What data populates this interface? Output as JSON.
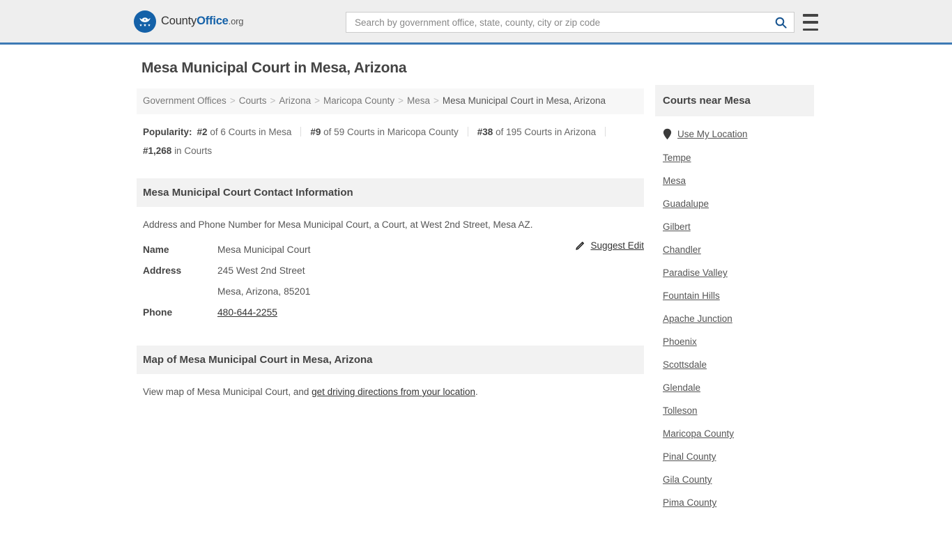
{
  "header": {
    "logo": {
      "name_part1": "County",
      "name_part2": "Office",
      "name_part3": ".org",
      "icon": "eagle-seal-icon"
    },
    "search": {
      "placeholder": "Search by government office, state, county, city or zip code",
      "value": "",
      "icon": "search-icon"
    },
    "menu_icon": "hamburger-menu-icon"
  },
  "main": {
    "page_title": "Mesa Municipal Court in Mesa, Arizona",
    "breadcrumb": {
      "items": [
        "Government Offices",
        "Courts",
        "Arizona",
        "Maricopa County",
        "Mesa"
      ],
      "current": "Mesa Municipal Court in Mesa, Arizona",
      "separator": ">"
    },
    "popularity": {
      "label": "Popularity:",
      "items": [
        {
          "rank": "#2",
          "text": "of 6 Courts in Mesa"
        },
        {
          "rank": "#9",
          "text": "of 59 Courts in Maricopa County"
        },
        {
          "rank": "#38",
          "text": "of 195 Courts in Arizona"
        },
        {
          "rank": "#1,268",
          "text": "in Courts"
        }
      ]
    },
    "contact_section": {
      "heading": "Mesa Municipal Court Contact Information",
      "description": "Address and Phone Number for Mesa Municipal Court, a Court, at West 2nd Street, Mesa AZ.",
      "rows": [
        {
          "key": "Name",
          "value": "Mesa Municipal Court",
          "link": false
        },
        {
          "key": "Address",
          "value": "245 West 2nd Street",
          "link": false
        },
        {
          "key": "",
          "value": "Mesa, Arizona, 85201",
          "link": false
        },
        {
          "key": "Phone",
          "value": "480-644-2255",
          "link": true
        }
      ],
      "suggest_edit": {
        "label": "Suggest Edit",
        "icon": "edit-pencil-icon"
      }
    },
    "map_section": {
      "heading": "Map of Mesa Municipal Court in Mesa, Arizona",
      "text_before": "View map of Mesa Municipal Court, and ",
      "link_text": "get driving directions from your location",
      "text_after": "."
    }
  },
  "sidebar": {
    "heading": "Courts near Mesa",
    "use_my_location": {
      "label": "Use My Location",
      "icon": "map-pin-icon"
    },
    "items": [
      "Tempe",
      "Mesa",
      "Guadalupe",
      "Gilbert",
      "Chandler",
      "Paradise Valley",
      "Fountain Hills",
      "Apache Junction",
      "Phoenix",
      "Scottsdale",
      "Glendale",
      "Tolleson",
      "Maricopa County",
      "Pinal County",
      "Gila County",
      "Pima County"
    ]
  },
  "colors": {
    "brand_blue": "#1461a8",
    "header_bg": "#eeeeee",
    "header_border": "#3d7ab5",
    "section_bg": "#f2f2f2",
    "breadcrumb_bg": "#f7f7f7"
  }
}
